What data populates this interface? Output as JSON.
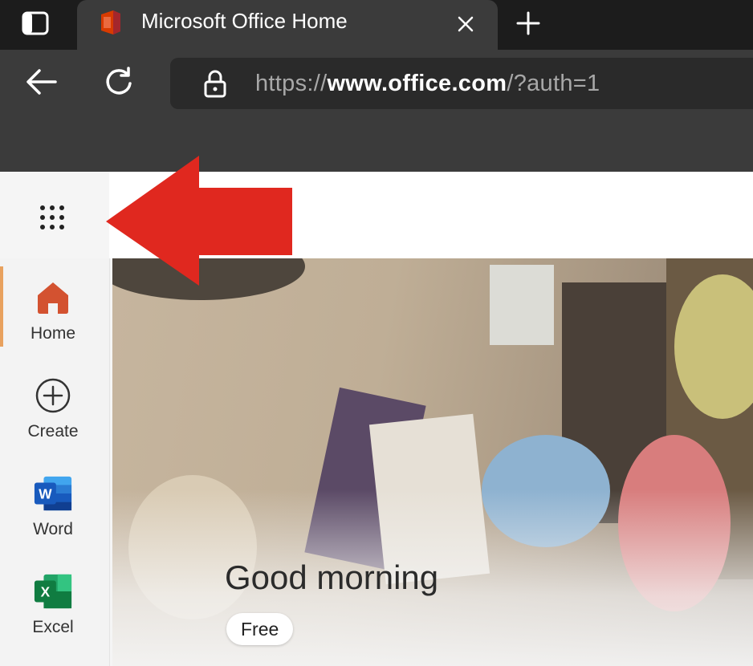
{
  "browser": {
    "tab": {
      "title": "Microsoft Office Home",
      "favicon": "office-logo-icon"
    },
    "address_bar": {
      "scheme": "https://",
      "host": "www.office.com",
      "path": "/?auth=1"
    }
  },
  "page": {
    "sidebar": {
      "items": [
        {
          "label": "Home",
          "icon": "home-icon",
          "active": true
        },
        {
          "label": "Create",
          "icon": "plus-circle-icon"
        },
        {
          "label": "Word",
          "icon": "word-icon"
        },
        {
          "label": "Excel",
          "icon": "excel-icon"
        }
      ]
    },
    "hero": {
      "greeting": "Good morning",
      "plan_badge": "Free"
    }
  },
  "annotation": {
    "icon": "red-arrow-icon",
    "color": "#e0281f"
  },
  "colors": {
    "home_icon": "#d35230",
    "word_blue": "#185abd",
    "excel_green": "#107c41",
    "active_indicator": "#e8a15e"
  }
}
